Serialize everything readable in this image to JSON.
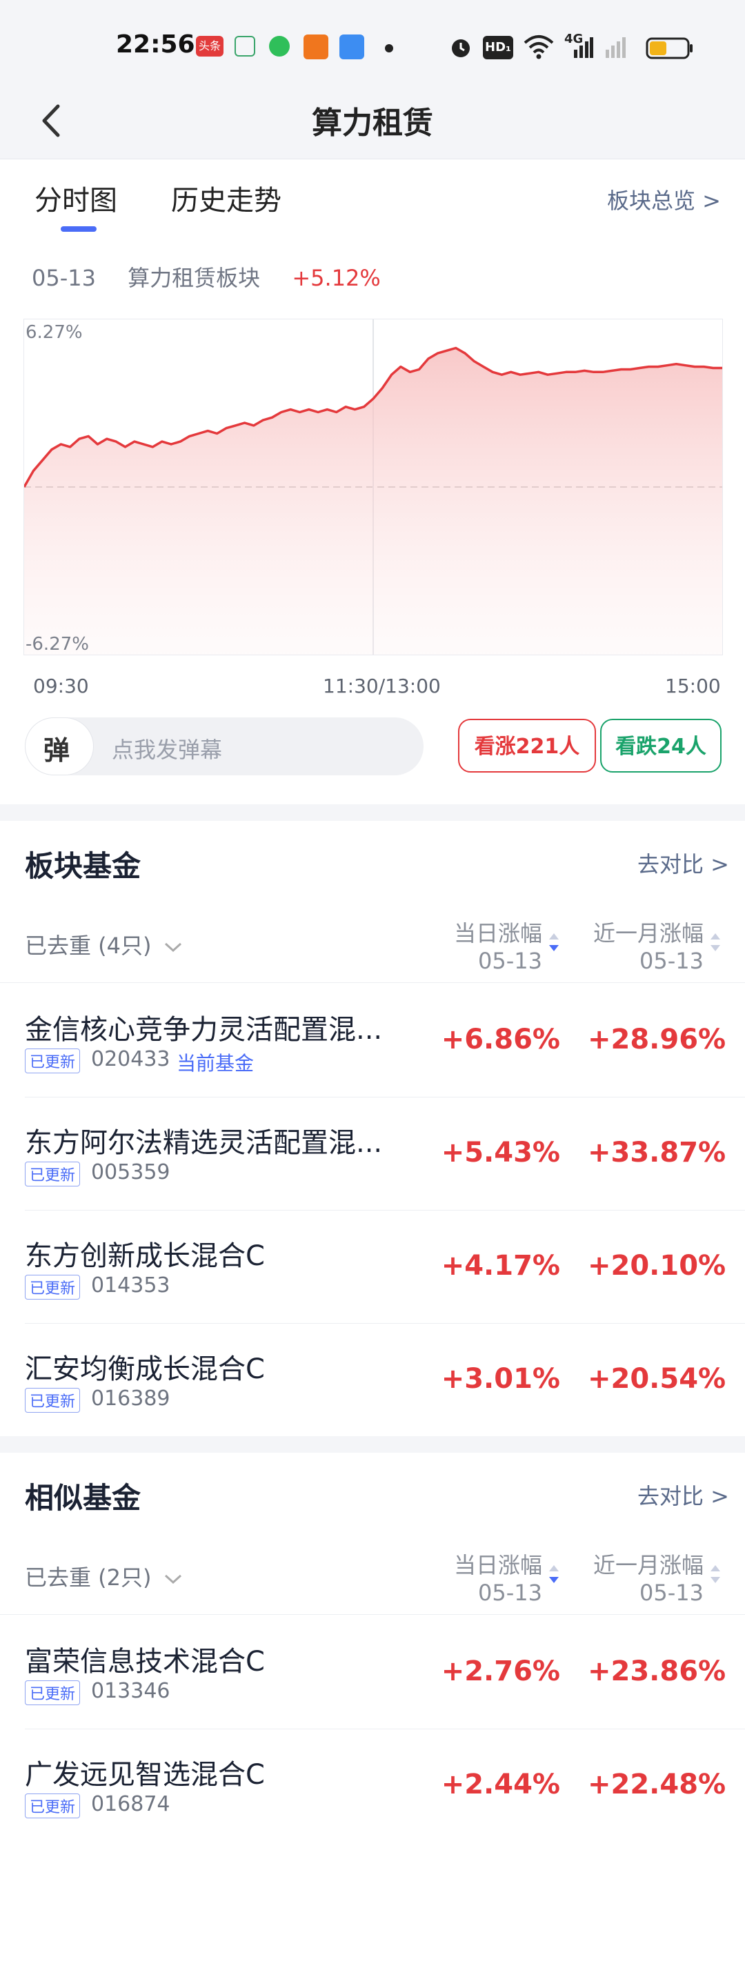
{
  "status_bar": {
    "time": "22:56",
    "icons": [
      "toutiao-app-icon",
      "home-app-icon",
      "chat-app-icon",
      "orange-app-icon",
      "weather-app-icon",
      "dot-icon",
      "alarm-icon",
      "hd-icon",
      "wifi-icon",
      "signal-4g-icon",
      "signal-icon",
      "battery-icon"
    ],
    "badge_toutiao": "头条",
    "badge_hd": "HD₁",
    "badge_4g": "4G"
  },
  "nav": {
    "title": "算力租赁"
  },
  "tabs": [
    {
      "label": "分时图",
      "active": true
    },
    {
      "label": "历史走势",
      "active": false
    }
  ],
  "overview_link": "板块总览 >",
  "summary": {
    "date": "05-13",
    "sector": "算力租赁板块",
    "change": "+5.12%"
  },
  "chart_data": {
    "type": "area",
    "y_top_label": "6.27%",
    "y_bottom_label": "-6.27%",
    "x_tick_labels": [
      "09:30",
      "11:30/13:00",
      "15:00"
    ],
    "ylim": [
      -6.27,
      6.27
    ],
    "series_color": "#e4393c",
    "grid": "dashed zero line, vertical line at midday",
    "values": [
      0.0,
      0.6,
      1.0,
      1.4,
      1.6,
      1.5,
      1.8,
      1.9,
      1.6,
      1.8,
      1.7,
      1.5,
      1.7,
      1.6,
      1.5,
      1.7,
      1.6,
      1.7,
      1.9,
      2.0,
      2.1,
      2.0,
      2.2,
      2.3,
      2.4,
      2.3,
      2.5,
      2.6,
      2.8,
      2.9,
      2.8,
      2.9,
      2.8,
      2.9,
      2.8,
      3.0,
      2.9,
      3.0,
      3.3,
      3.7,
      4.2,
      4.5,
      4.3,
      4.4,
      4.8,
      5.0,
      5.1,
      5.2,
      5.0,
      4.7,
      4.5,
      4.3,
      4.2,
      4.3,
      4.2,
      4.25,
      4.3,
      4.2,
      4.25,
      4.3,
      4.3,
      4.35,
      4.3,
      4.3,
      4.35,
      4.4,
      4.4,
      4.45,
      4.5,
      4.5,
      4.55,
      4.6,
      4.55,
      4.5,
      4.5,
      4.45,
      4.45
    ]
  },
  "danmaku": {
    "badge": "弹",
    "placeholder": "点我发弹幕"
  },
  "votes": {
    "up": "看涨221人",
    "down": "看跌24人"
  },
  "sector_funds": {
    "title": "板块基金",
    "compare": "去对比 >",
    "dedup": "已去重 (4只)",
    "col_day": "当日涨幅",
    "col_day_date": "05-13",
    "col_month": "近一月涨幅",
    "col_month_date": "05-13",
    "rows": [
      {
        "name": "金信核心竞争力灵活配置混...",
        "badge": "已更新",
        "code": "020433",
        "tag": "当前基金",
        "day": "+6.86%",
        "month": "+28.96%"
      },
      {
        "name": "东方阿尔法精选灵活配置混...",
        "badge": "已更新",
        "code": "005359",
        "tag": "",
        "day": "+5.43%",
        "month": "+33.87%"
      },
      {
        "name": "东方创新成长混合C",
        "badge": "已更新",
        "code": "014353",
        "tag": "",
        "day": "+4.17%",
        "month": "+20.10%"
      },
      {
        "name": "汇安均衡成长混合C",
        "badge": "已更新",
        "code": "016389",
        "tag": "",
        "day": "+3.01%",
        "month": "+20.54%"
      }
    ]
  },
  "similar_funds": {
    "title": "相似基金",
    "compare": "去对比 >",
    "dedup": "已去重 (2只)",
    "col_day": "当日涨幅",
    "col_day_date": "05-13",
    "col_month": "近一月涨幅",
    "col_month_date": "05-13",
    "rows": [
      {
        "name": "富荣信息技术混合C",
        "badge": "已更新",
        "code": "013346",
        "tag": "",
        "day": "+2.76%",
        "month": "+23.86%"
      },
      {
        "name": "广发远见智选混合C",
        "badge": "已更新",
        "code": "016874",
        "tag": "",
        "day": "+2.44%",
        "month": "+22.48%"
      }
    ]
  }
}
